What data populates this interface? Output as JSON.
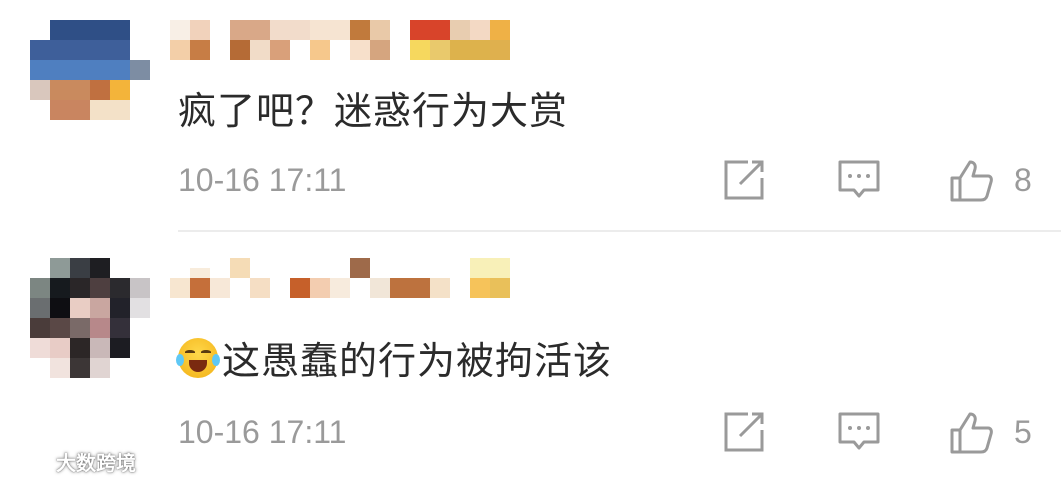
{
  "comments": [
    {
      "text": "疯了吧？迷惑行为大赏",
      "time": "10-16 17:11",
      "likes": "8"
    },
    {
      "emoji": "laugh-cry-emoji",
      "text": "这愚蠢的行为被拘活该",
      "time": "10-16 17:11",
      "likes": "5"
    }
  ],
  "icons": {
    "share": "share-icon",
    "reply": "comment-icon",
    "like": "thumbs-up-icon"
  },
  "watermark": {
    "text": "大数跨境"
  },
  "colors": {
    "text": "#2b2b2b",
    "meta": "#9a9a9a",
    "divider": "#ececec"
  }
}
